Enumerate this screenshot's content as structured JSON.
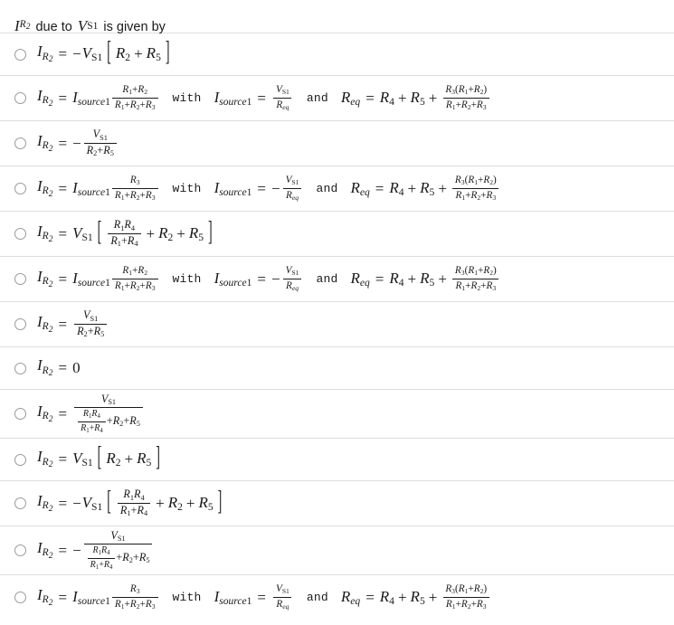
{
  "question": {
    "current_symbol": "I",
    "current_sub": "R",
    "current_sub2": "2",
    "due_to_text": "due to",
    "source_symbol": "V",
    "source_sub": "S1",
    "tail_text": "is given by"
  },
  "symbols": {
    "I": "I",
    "V": "V",
    "R": "R",
    "R_sub": "R",
    "two": "2",
    "three": "3",
    "four": "4",
    "five": "5",
    "one": "1",
    "S1": "S1",
    "eq": "eq",
    "source1_italic": "source",
    "source1_num": "1",
    "equals": "=",
    "plus": "+",
    "minus": "−",
    "zero": "0",
    "with": "with",
    "and": "and",
    "lbracket": "[",
    "rbracket": "]",
    "lparen": "(",
    "rparen": ")"
  },
  "options": [
    {
      "id": "opt-1",
      "kind": "bracket-simple",
      "latex": "I_{R_2} = -V_{S1}[R_2 + R_5]",
      "sign": "−"
    },
    {
      "id": "opt-2",
      "kind": "source-form",
      "latex": "I_{R_2} = I_{source1} (R_1+R_2)/(R_1+R_2+R_3) with I_{source1} = V_{S1}/R_{eq} and R_{eq} = R_4 + R_5 + R_3(R_1+R_2)/(R_1+R_2+R_3)",
      "numerator": "R1+R2",
      "source_sign": "",
      "req_text": "R4 + R5 + R3(R1+R2)/(R1+R2+R3)"
    },
    {
      "id": "opt-3",
      "kind": "frac-simple",
      "latex": "I_{R_2} = -V_{S1}/(R_2+R_5)",
      "sign": "−"
    },
    {
      "id": "opt-4",
      "kind": "source-form",
      "latex": "I_{R_2} = I_{source1} R_3/(R_1+R_2+R_3) with I_{source1} = -V_{S1}/R_{eq} and R_{eq} = R_4 + R_5 + R_3(R_1+R_2)/(R_1+R_2+R_3)",
      "numerator": "R3",
      "source_sign": "−",
      "req_text": "R4 + R5 + R3(R1+R2)/(R1+R2+R3)"
    },
    {
      "id": "opt-5",
      "kind": "bracket-parallel",
      "latex": "I_{R_2} = V_{S1}[R_1R_4/(R_1+R_4) + R_2 + R_5]",
      "sign": ""
    },
    {
      "id": "opt-6",
      "kind": "source-form",
      "latex": "I_{R_2} = I_{source1} (R_1+R_2)/(R_1+R_2+R_3) with I_{source1} = -V_{S1}/R_{eq} and R_{eq} = R_4 + R_5 + R_3(R_1+R_2)/(R_1+R_2+R_3)",
      "numerator": "R1+R2",
      "source_sign": "−",
      "req_text": "R4 + R5 + R3(R1+R2)/(R1+R2+R3)"
    },
    {
      "id": "opt-7",
      "kind": "frac-simple",
      "latex": "I_{R_2} = V_{S1}/(R_2+R_5)",
      "sign": ""
    },
    {
      "id": "opt-8",
      "kind": "zero",
      "latex": "I_{R_2} = 0",
      "value": "0"
    },
    {
      "id": "opt-9",
      "kind": "frac-nested",
      "latex": "I_{R_2} = V_{S1}/(R_1R_4/(R_1+R_4) + R_2 + R_5)",
      "sign": ""
    },
    {
      "id": "opt-10",
      "kind": "bracket-simple",
      "latex": "I_{R_2} = V_{S1}[R_2 + R_5]",
      "sign": ""
    },
    {
      "id": "opt-11",
      "kind": "bracket-parallel",
      "latex": "I_{R_2} = -V_{S1}[R_1R_4/(R_1+R_4) + R_2 + R_5]",
      "sign": "−"
    },
    {
      "id": "opt-12",
      "kind": "frac-nested",
      "latex": "I_{R_2} = -V_{S1}/(R_1R_4/(R_1+R_4) + R_2 + R_5)",
      "sign": "−"
    },
    {
      "id": "opt-13",
      "kind": "source-form",
      "latex": "I_{R_2} = I_{source1} R_3/(R_1+R_2+R_3) with I_{source1} = V_{S1}/R_{eq} and R_{eq} = R_4 + R_5 + R_3(R_1+R_2)/(R_1+R_2+R_3)",
      "numerator": "R3",
      "source_sign": "",
      "req_text": "R4 + R5 + R3(R1+R2)/(R1+R2+R3)"
    }
  ]
}
